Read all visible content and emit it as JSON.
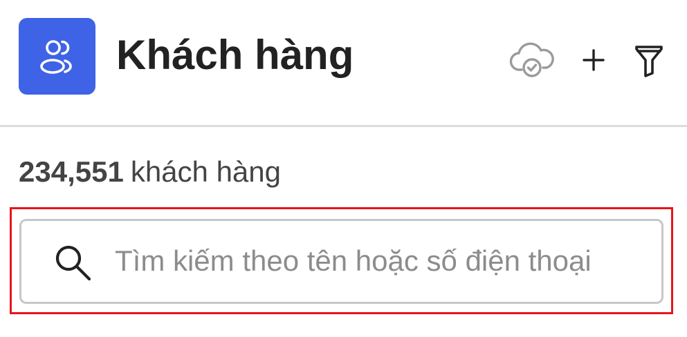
{
  "header": {
    "app_icon": "users-icon",
    "title": "Khách hàng",
    "actions": [
      {
        "icon": "cloud-check-icon",
        "label": "sync"
      },
      {
        "icon": "plus-icon",
        "label": "add"
      },
      {
        "icon": "filter-icon",
        "label": "filter"
      }
    ]
  },
  "summary": {
    "count": "234,551",
    "count_label": "khách hàng"
  },
  "search": {
    "icon": "search-icon",
    "value": "",
    "placeholder": "Tìm kiếm theo tên hoặc số điện thoại"
  },
  "colors": {
    "brand": "#3f63e6",
    "highlight": "#e8141a",
    "border": "#c7c7c7",
    "divider": "#dcdcdc"
  }
}
